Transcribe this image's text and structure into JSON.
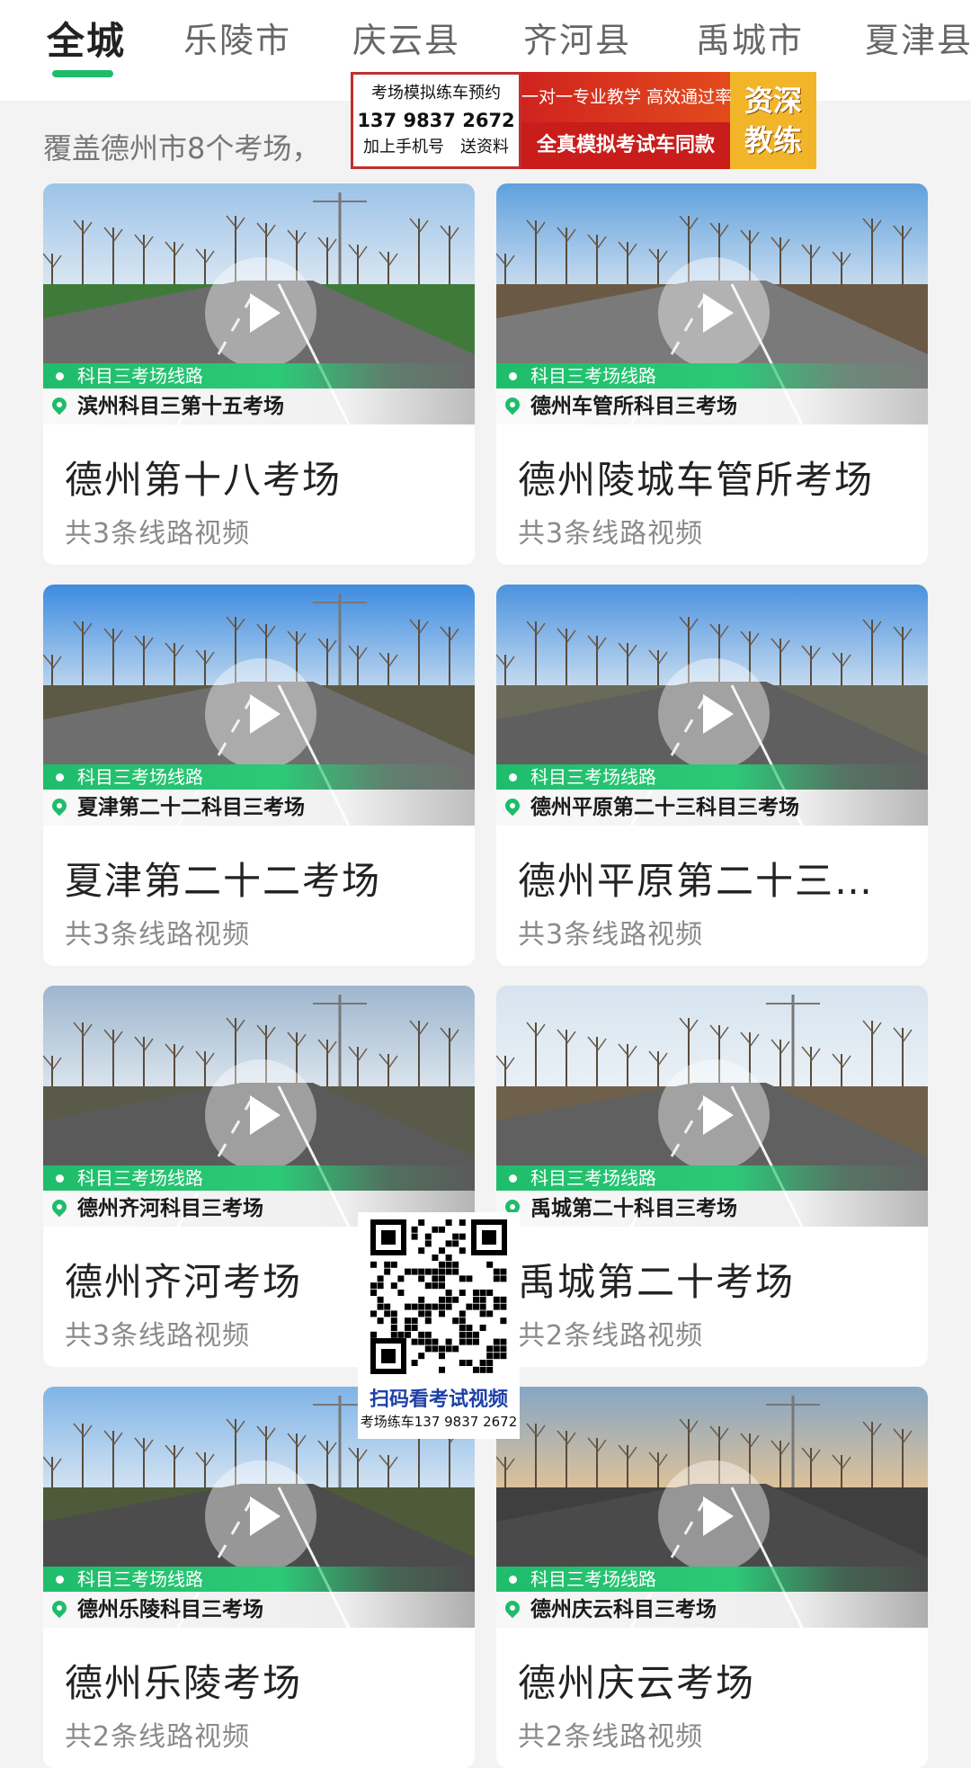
{
  "tabs": [
    {
      "label": "全城"
    },
    {
      "label": "乐陵市"
    },
    {
      "label": "庆云县"
    },
    {
      "label": "齐河县"
    },
    {
      "label": "禹城市"
    },
    {
      "label": "夏津县"
    }
  ],
  "coverage_text": "覆盖德州市8个考场，",
  "ad": {
    "line1": "考场模拟练车预约",
    "phone": "137 9837 2672",
    "line3": "加上手机号　送资料",
    "slogan_top": "一对一专业教学 高效通过率",
    "slogan_bottom": "全真模拟考试车同款",
    "badge_1": "资深",
    "badge_2": "教练"
  },
  "cards": [
    {
      "tag": "科目三考场线路",
      "location": "滨州科目三第十五考场",
      "title": "德州第十八考场",
      "sub": "共3条线路视频"
    },
    {
      "tag": "科目三考场线路",
      "location": "德州车管所科目三考场",
      "title": "德州陵城车管所考场",
      "sub": "共3条线路视频"
    },
    {
      "tag": "科目三考场线路",
      "location": "夏津第二十二科目三考场",
      "title": "夏津第二十二考场",
      "sub": "共3条线路视频"
    },
    {
      "tag": "科目三考场线路",
      "location": "德州平原第二十三科目三考场",
      "title": "德州平原第二十三…",
      "sub": "共3条线路视频"
    },
    {
      "tag": "科目三考场线路",
      "location": "德州齐河科目三考场",
      "title": "德州齐河考场",
      "sub": "共3条线路视频"
    },
    {
      "tag": "科目三考场线路",
      "location": "禹城第二十科目三考场",
      "title": "禹城第二十考场",
      "sub": "共2条线路视频"
    },
    {
      "tag": "科目三考场线路",
      "location": "德州乐陵科目三考场",
      "title": "德州乐陵考场",
      "sub": "共2条线路视频"
    },
    {
      "tag": "科目三考场线路",
      "location": "德州庆云科目三考场",
      "title": "德州庆云考场",
      "sub": "共2条线路视频"
    }
  ],
  "qr": {
    "caption": "扫码看考试视频",
    "phone_line": "考场练车137 9837 2672"
  },
  "colors": {
    "accent": "#1fbd6b",
    "ad_red": "#c81d1b",
    "ad_gold": "#f2b52a"
  }
}
